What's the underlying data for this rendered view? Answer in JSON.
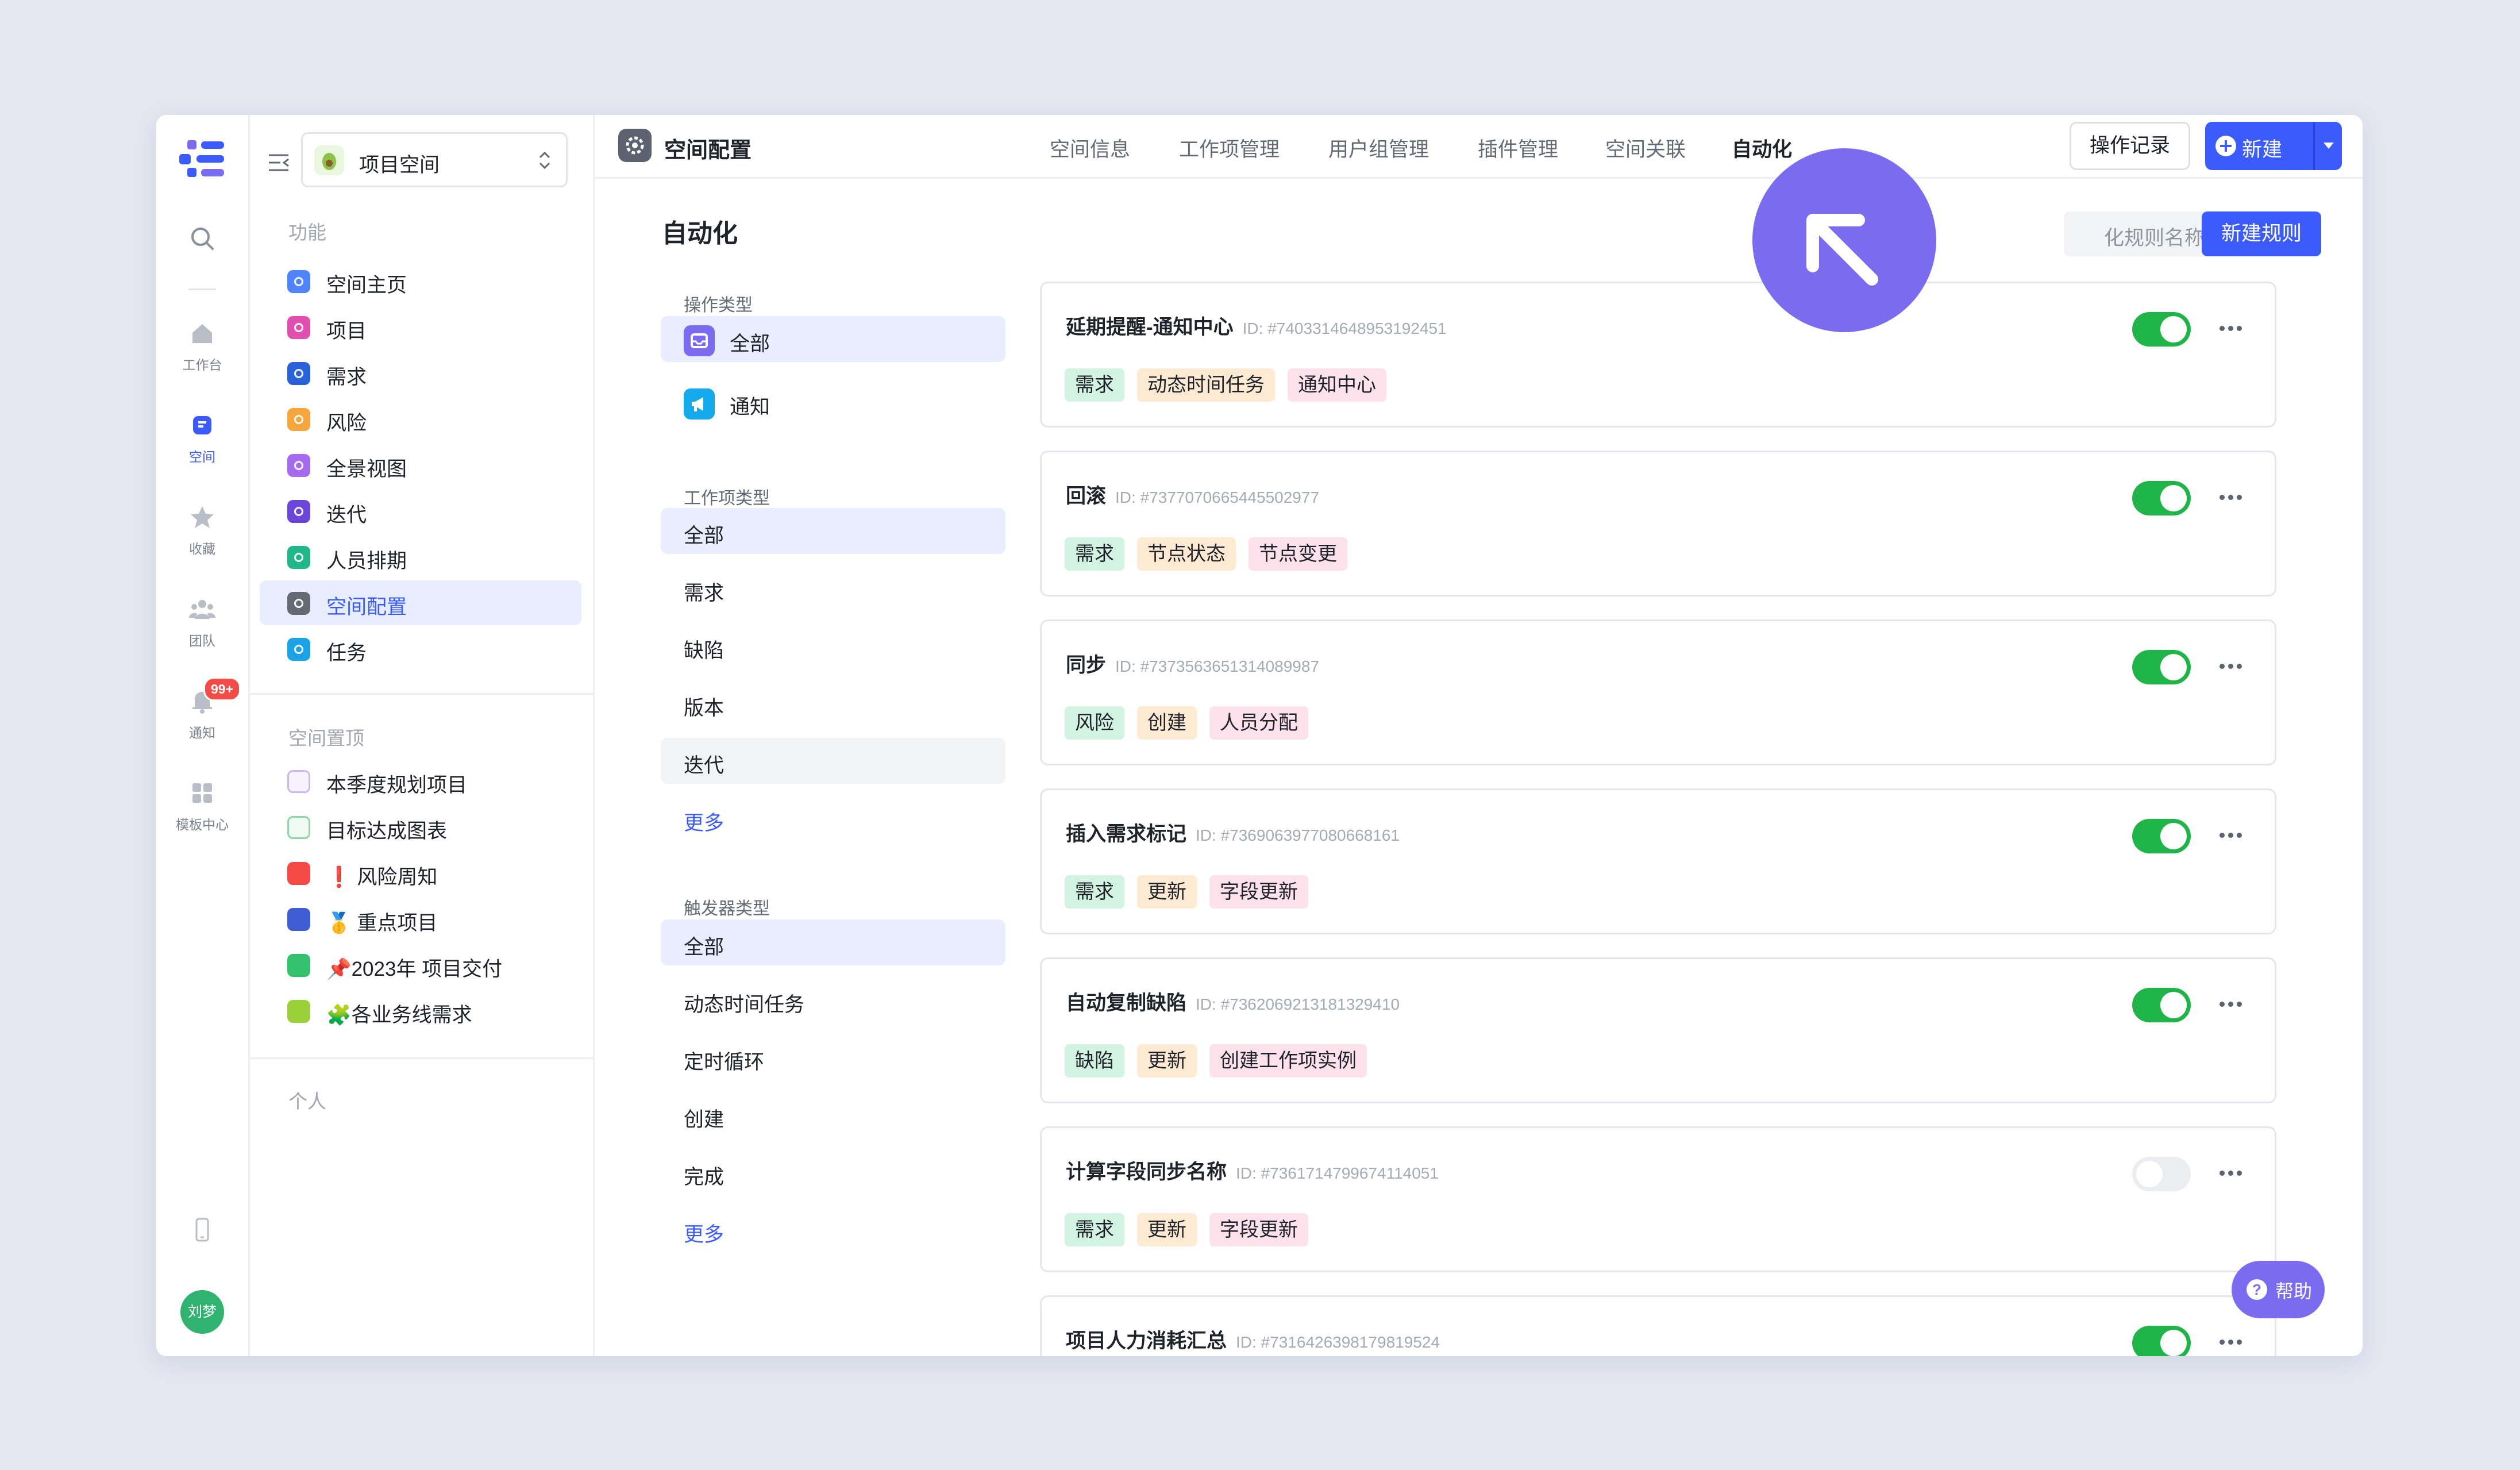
{
  "rail": {
    "items": [
      {
        "label": "工作台"
      },
      {
        "label": "空间"
      },
      {
        "label": "收藏"
      },
      {
        "label": "团队"
      },
      {
        "label": "通知"
      },
      {
        "label": "模板中心"
      }
    ],
    "notification_badge": "99+",
    "avatar_text": "刘梦"
  },
  "side": {
    "space_name": "项目空间",
    "section_features": "功能",
    "features": [
      {
        "label": "空间主页",
        "color": "#4e83fd"
      },
      {
        "label": "项目",
        "color": "#e04fae"
      },
      {
        "label": "需求",
        "color": "#2a62d9"
      },
      {
        "label": "风险",
        "color": "#f5a53a"
      },
      {
        "label": "全景视图",
        "color": "#a46bf0"
      },
      {
        "label": "迭代",
        "color": "#6b46d8"
      },
      {
        "label": "人员排期",
        "color": "#1fb78a"
      },
      {
        "label": "空间配置",
        "color": "#646a73"
      },
      {
        "label": "任务",
        "color": "#1ba1e6"
      }
    ],
    "section_pinned": "空间置顶",
    "pinned": [
      {
        "label": "本季度规划项目",
        "emoji": ""
      },
      {
        "label": "目标达成图表",
        "emoji": ""
      },
      {
        "label": "风险周知",
        "emoji": "❗"
      },
      {
        "label": "重点项目",
        "emoji": "🥇"
      },
      {
        "label": "2023年 项目交付",
        "emoji": "📌"
      },
      {
        "label": "各业务线需求",
        "emoji": "🧩"
      }
    ],
    "section_personal": "个人"
  },
  "topbar": {
    "title": "空间配置",
    "tabs": [
      "空间信息",
      "工作项管理",
      "用户组管理",
      "插件管理",
      "空间关联",
      "自动化"
    ],
    "active_tab": "自动化",
    "log_button": "操作记录",
    "new_button": "新建"
  },
  "content": {
    "heading": "自动化",
    "search_placeholder": "化规则名称或 ID",
    "new_rule_button": "新建规则",
    "filters": {
      "op_type_title": "操作类型",
      "op_types": [
        "全部",
        "通知"
      ],
      "item_type_title": "工作项类型",
      "item_types": [
        "全部",
        "需求",
        "缺陷",
        "版本",
        "迭代"
      ],
      "item_more": "更多",
      "trigger_title": "触发器类型",
      "triggers": [
        "全部",
        "动态时间任务",
        "定时循环",
        "创建",
        "完成"
      ],
      "trigger_more": "更多"
    },
    "id_prefix": "ID:",
    "rules": [
      {
        "name": "延期提醒-通知中心",
        "id": "#7403314648953192451",
        "enabled": true,
        "tags": [
          "需求",
          "动态时间任务",
          "通知中心"
        ]
      },
      {
        "name": "回滚",
        "id": "#7377070665445502977",
        "enabled": true,
        "tags": [
          "需求",
          "节点状态",
          "节点变更"
        ]
      },
      {
        "name": "同步",
        "id": "#7373563651314089987",
        "enabled": true,
        "tags": [
          "风险",
          "创建",
          "人员分配"
        ]
      },
      {
        "name": "插入需求标记",
        "id": "#7369063977080668161",
        "enabled": true,
        "tags": [
          "需求",
          "更新",
          "字段更新"
        ]
      },
      {
        "name": "自动复制缺陷",
        "id": "#7362069213181329410",
        "enabled": true,
        "tags": [
          "缺陷",
          "更新",
          "创建工作项实例"
        ]
      },
      {
        "name": "计算字段同步名称",
        "id": "#7361714799674114051",
        "enabled": false,
        "tags": [
          "需求",
          "更新",
          "字段更新"
        ]
      },
      {
        "name": "项目人力消耗汇总",
        "id": "#7316426398179819524",
        "enabled": true,
        "tags": []
      }
    ],
    "help_button": "帮助"
  },
  "colors": {
    "accent": "#3b5bfd",
    "toggle_on": "#1fb447",
    "cursor": "#7b6bf0"
  }
}
